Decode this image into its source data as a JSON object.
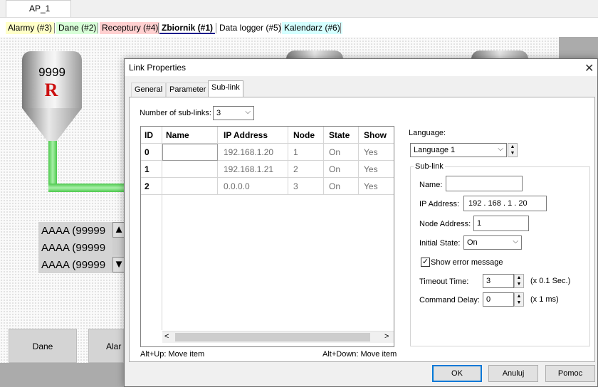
{
  "document_tab": "AP_1",
  "page_tabs": [
    {
      "label": "Alarmy (#3)",
      "color": "#ffffc8"
    },
    {
      "label": "Dane (#2)",
      "color": "#d8ffd8"
    },
    {
      "label": "Receptury (#4)",
      "color": "#ffd0d0"
    },
    {
      "label": "Zbiornik (#1)",
      "color": "#ffffff"
    },
    {
      "label": "Data logger (#5)",
      "color": "#ffffff"
    },
    {
      "label": "Kalendarz (#6)",
      "color": "#d4ffff"
    }
  ],
  "canvas": {
    "tank_value": "9999",
    "tank_letter": "R",
    "list_items": [
      "AAAA (99999",
      "AAAA (99999",
      "AAAA (99999"
    ],
    "buttons": [
      "Dane",
      "Alar"
    ]
  },
  "dialog": {
    "title": "Link Properties",
    "tabs": [
      "General",
      "Parameter",
      "Sub-link"
    ],
    "active_tab": "Sub-link",
    "num_sublinks_label": "Number of sub-links:",
    "num_sublinks_value": "3",
    "grid": {
      "columns": [
        "ID",
        "Name",
        "IP Address",
        "Node",
        "State",
        "Show"
      ],
      "rows": [
        {
          "id": "0",
          "name": "",
          "ip": "192.168.1.20",
          "node": "1",
          "state": "On",
          "show": "Yes"
        },
        {
          "id": "1",
          "name": "",
          "ip": "192.168.1.21",
          "node": "2",
          "state": "On",
          "show": "Yes"
        },
        {
          "id": "2",
          "name": "",
          "ip": "0.0.0.0",
          "node": "3",
          "state": "On",
          "show": "Yes"
        }
      ]
    },
    "hint_up": "Alt+Up: Move item",
    "hint_down": "Alt+Down: Move item",
    "language_label": "Language:",
    "language_value": "Language 1",
    "sublink_group_label": "Sub-link",
    "name_label": "Name:",
    "name_value": "",
    "ip_label": "IP Address:",
    "ip_octets": [
      "192",
      "168",
      "1",
      "20"
    ],
    "node_label": "Node Address:",
    "node_value": "1",
    "initial_state_label": "Initial State:",
    "initial_state_value": "On",
    "show_error_label": "Show error message",
    "show_error_checked": true,
    "timeout_label": "Timeout Time:",
    "timeout_value": "3",
    "timeout_unit": "(x 0.1 Sec.)",
    "cmd_delay_label": "Command Delay:",
    "cmd_delay_value": "0",
    "cmd_delay_unit": "(x 1 ms)",
    "ok_label": "OK",
    "cancel_label": "Anuluj",
    "help_label": "Pomoc"
  }
}
